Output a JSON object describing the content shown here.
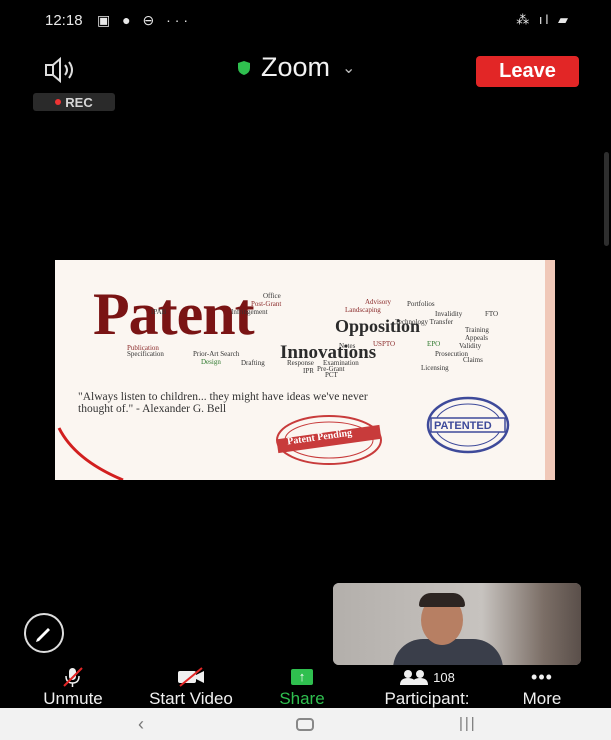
{
  "status_bar": {
    "time": "12:18",
    "left_icons": "▣ ● ⊖ ···",
    "right_icons": "⁂ ıl ▰"
  },
  "meeting": {
    "title": "Zoom",
    "leave_label": "Leave",
    "rec_label": "REC"
  },
  "slide": {
    "title": "Patent",
    "opposition": "Opposition",
    "innovations": "Innovations",
    "quote": "\"Always listen to children... they might have ideas we've never thought of.\" - Alexander G. Bell",
    "stamp_pending": "Patent Pending",
    "stamp_patented": "PATENTED",
    "wordcloud": [
      "Office",
      "Post-Grant",
      "Infringement",
      "IPAB",
      "Advisory",
      "Portfolios",
      "Landscaping",
      "Specification",
      "Publication",
      "Prior-Art Search",
      "Drafting",
      "Response",
      "Examination",
      "Pre-Grant",
      "Technology Transfer",
      "Invalidity",
      "FTO",
      "Training",
      "Appeals",
      "Validity",
      "Prosecution",
      "Claims",
      "IPR",
      "PCT",
      "Design",
      "USPTO",
      "Notes",
      "EPO",
      "Licensing"
    ]
  },
  "toolbar": {
    "unmute_label": "Unmute",
    "start_video_label": "Start Video",
    "share_label": "Share",
    "participants_label": "Participant:",
    "participants_count": "108",
    "more_label": "More"
  },
  "colors": {
    "leave": "#e22626",
    "share": "#2fbf4f",
    "background": "#000000"
  }
}
